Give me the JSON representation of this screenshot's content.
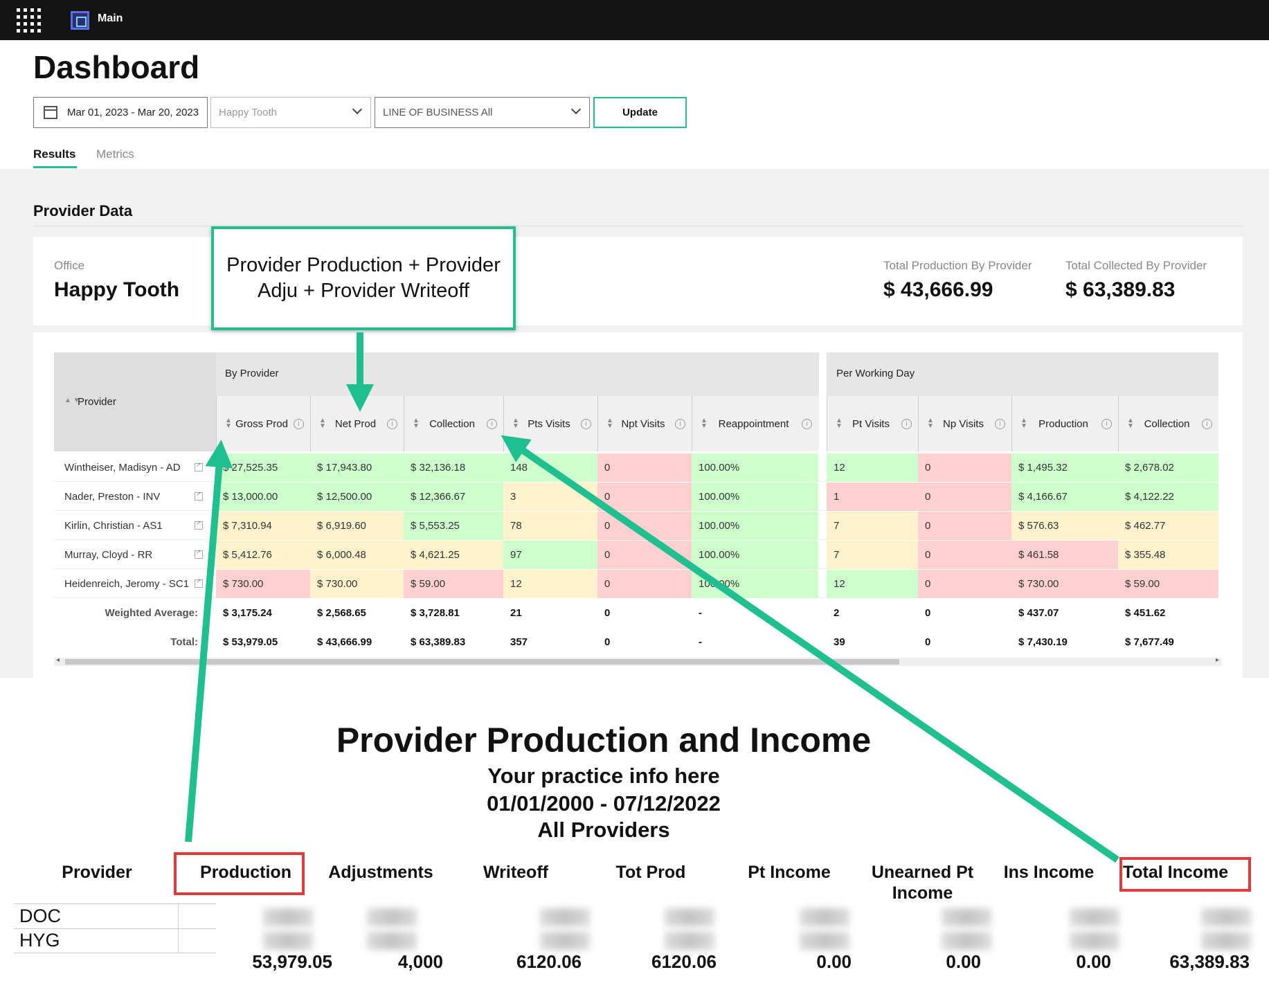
{
  "app": {
    "name": "Main"
  },
  "page": {
    "title": "Dashboard"
  },
  "filters": {
    "date_range": "Mar 01, 2023 - Mar 20, 2023",
    "office": "Happy Tooth",
    "line_of_business": "LINE OF BUSINESS All",
    "update_label": "Update"
  },
  "tabs": [
    "Results",
    "Metrics"
  ],
  "section": {
    "title": "Provider Data"
  },
  "summary": {
    "office_label": "Office",
    "office_value": "Happy Tooth",
    "total_production_label": "Total Production By Provider",
    "total_production_value": "$ 43,666.99",
    "total_collected_label": "Total Collected By Provider",
    "total_collected_value": "$ 63,389.83"
  },
  "callout": {
    "text": "Provider Production + Provider Adju + Provider Writeoff"
  },
  "table": {
    "provider_header": "Provider",
    "group_by_provider": "By Provider",
    "group_per_day": "Per Working Day",
    "columns": [
      "Gross Prod",
      "Net Prod",
      "Collection",
      "Pts Visits",
      "Npt Visits",
      "Reappointment",
      "Pt Visits",
      "Np Visits",
      "Production",
      "Collection"
    ],
    "rows": [
      {
        "name": "Wintheiser, Madisyn - AD",
        "cells": [
          "$ 27,525.35",
          "$ 17,943.80",
          "$ 32,136.18",
          "148",
          "0",
          "100.00%",
          "12",
          "0",
          "$ 1,495.32",
          "$ 2,678.02"
        ],
        "colors": [
          "green",
          "green",
          "green",
          "green",
          "red",
          "green",
          "green",
          "red",
          "green",
          "green"
        ]
      },
      {
        "name": "Nader, Preston - INV",
        "cells": [
          "$ 13,000.00",
          "$ 12,500.00",
          "$ 12,366.67",
          "3",
          "0",
          "100.00%",
          "1",
          "0",
          "$ 4,166.67",
          "$ 4,122.22"
        ],
        "colors": [
          "green",
          "green",
          "green",
          "yellow",
          "red",
          "green",
          "red",
          "red",
          "green",
          "green"
        ]
      },
      {
        "name": "Kirlin, Christian - AS1",
        "cells": [
          "$ 7,310.94",
          "$ 6,919.60",
          "$ 5,553.25",
          "78",
          "0",
          "100.00%",
          "7",
          "0",
          "$ 576.63",
          "$ 462.77"
        ],
        "colors": [
          "yellow",
          "yellow",
          "green",
          "yellow",
          "red",
          "green",
          "yellow",
          "red",
          "yellow",
          "yellow"
        ]
      },
      {
        "name": "Murray, Cloyd - RR",
        "cells": [
          "$ 5,412.76",
          "$ 6,000.48",
          "$ 4,621.25",
          "97",
          "0",
          "100.00%",
          "7",
          "0",
          "$ 461.58",
          "$ 355.48"
        ],
        "colors": [
          "yellow",
          "yellow",
          "yellow",
          "green",
          "red",
          "green",
          "yellow",
          "red",
          "red",
          "yellow"
        ]
      },
      {
        "name": "Heidenreich, Jeromy - SC1",
        "cells": [
          "$ 730.00",
          "$ 730.00",
          "$ 59.00",
          "12",
          "0",
          "100.00%",
          "12",
          "0",
          "$ 730.00",
          "$ 59.00"
        ],
        "colors": [
          "red",
          "yellow",
          "red",
          "yellow",
          "red",
          "green",
          "green",
          "red",
          "red",
          "red"
        ]
      }
    ],
    "weighted_average_label": "Weighted Average:",
    "weighted_average": [
      "$ 3,175.24",
      "$ 2,568.65",
      "$ 3,728.81",
      "21",
      "0",
      "-",
      "2",
      "0",
      "$ 437.07",
      "$ 451.62"
    ],
    "total_label": "Total:",
    "total": [
      "$ 53,979.05",
      "$ 43,666.99",
      "$ 63,389.83",
      "357",
      "0",
      "-",
      "39",
      "0",
      "$ 7,430.19",
      "$ 7,677.49"
    ]
  },
  "report": {
    "title": "Provider Production and Income",
    "subtitle_lines": [
      "Your practice info here",
      "01/01/2000 - 07/12/2022",
      "All Providers"
    ],
    "columns": [
      "Provider",
      "Production",
      "Adjustments",
      "Writeoff",
      "Tot Prod",
      "Pt Income",
      "Unearned Pt Income",
      "Ins Income",
      "Total Income"
    ],
    "rows": [
      "DOC",
      "HYG"
    ],
    "totals": [
      "53,979.05",
      "4,000",
      "6120.06",
      "6120.06",
      "0.00",
      "0.00",
      "0.00",
      "63,389.83"
    ]
  },
  "colors": {
    "accent": "#1fbf8f",
    "highlight_box": "#e03a3a",
    "cell_green": "#ccffcc",
    "cell_yellow": "#fff2cc",
    "cell_red": "#ffd0d0"
  }
}
